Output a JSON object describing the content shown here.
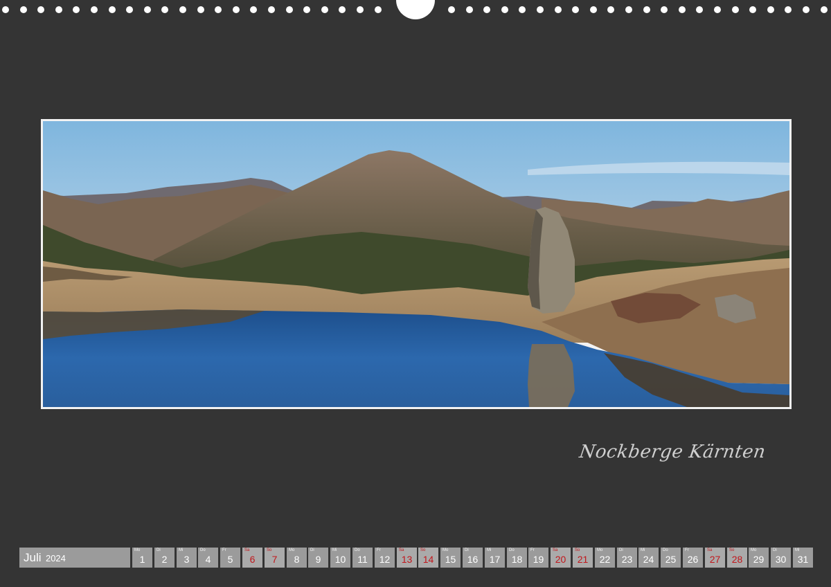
{
  "caption": "Nockberge Kärnten",
  "calendar": {
    "month": "Juli",
    "year": "2024",
    "days": [
      {
        "wd": "Mo",
        "d": "1",
        "weekend": false
      },
      {
        "wd": "Di",
        "d": "2",
        "weekend": false
      },
      {
        "wd": "Mi",
        "d": "3",
        "weekend": false
      },
      {
        "wd": "Do",
        "d": "4",
        "weekend": false
      },
      {
        "wd": "Fr",
        "d": "5",
        "weekend": false
      },
      {
        "wd": "Sa",
        "d": "6",
        "weekend": true
      },
      {
        "wd": "So",
        "d": "7",
        "weekend": true
      },
      {
        "wd": "Mo",
        "d": "8",
        "weekend": false
      },
      {
        "wd": "Di",
        "d": "9",
        "weekend": false
      },
      {
        "wd": "Mi",
        "d": "10",
        "weekend": false
      },
      {
        "wd": "Do",
        "d": "11",
        "weekend": false
      },
      {
        "wd": "Fr",
        "d": "12",
        "weekend": false
      },
      {
        "wd": "Sa",
        "d": "13",
        "weekend": true
      },
      {
        "wd": "So",
        "d": "14",
        "weekend": true
      },
      {
        "wd": "Mo",
        "d": "15",
        "weekend": false
      },
      {
        "wd": "Di",
        "d": "16",
        "weekend": false
      },
      {
        "wd": "Mi",
        "d": "17",
        "weekend": false
      },
      {
        "wd": "Do",
        "d": "18",
        "weekend": false
      },
      {
        "wd": "Fr",
        "d": "19",
        "weekend": false
      },
      {
        "wd": "Sa",
        "d": "20",
        "weekend": true
      },
      {
        "wd": "So",
        "d": "21",
        "weekend": true
      },
      {
        "wd": "Mo",
        "d": "22",
        "weekend": false
      },
      {
        "wd": "Di",
        "d": "23",
        "weekend": false
      },
      {
        "wd": "Mi",
        "d": "24",
        "weekend": false
      },
      {
        "wd": "Do",
        "d": "25",
        "weekend": false
      },
      {
        "wd": "Fr",
        "d": "26",
        "weekend": false
      },
      {
        "wd": "Sa",
        "d": "27",
        "weekend": true
      },
      {
        "wd": "So",
        "d": "28",
        "weekend": true
      },
      {
        "wd": "Mo",
        "d": "29",
        "weekend": false
      },
      {
        "wd": "Di",
        "d": "30",
        "weekend": false
      },
      {
        "wd": "Mi",
        "d": "31",
        "weekend": false
      }
    ]
  },
  "colors": {
    "background": "#343434",
    "calendar_cell": "#9b9b9b",
    "weekend_text": "#c2161b",
    "caption_text": "#cfcfcf"
  }
}
